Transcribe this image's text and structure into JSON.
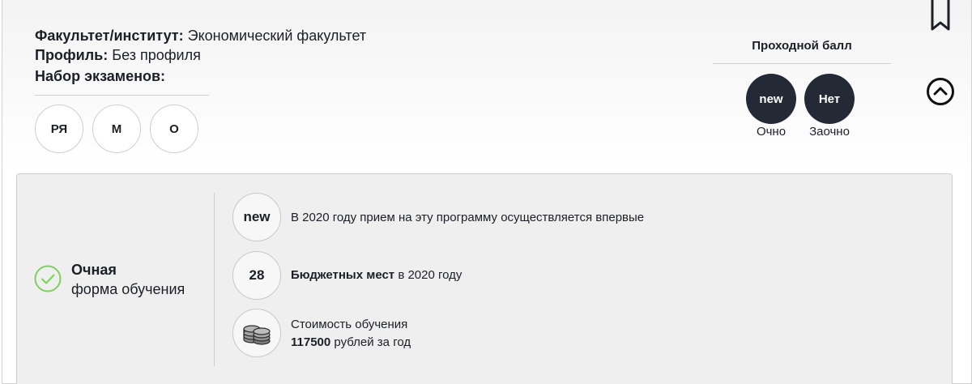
{
  "header": {
    "faculty_label": "Факультет/институт:",
    "faculty_value": "Экономический факультет",
    "profile_label": "Профиль:",
    "profile_value": "Без профиля",
    "exams_title": "Набор экзаменов:",
    "exams": [
      "РЯ",
      "М",
      "О"
    ]
  },
  "passing_score": {
    "title": "Проходной балл",
    "items": [
      {
        "value": "new",
        "label": "Очно"
      },
      {
        "value": "Нет",
        "label": "Заочно"
      }
    ]
  },
  "icons": {
    "bookmark": "bookmark-icon",
    "collapse": "chevron-up-circle-icon",
    "check": "check-circle-icon",
    "coins": "coins-icon"
  },
  "colors": {
    "dark_circle": "#232a35",
    "check_green": "#7fcf5e",
    "panel_bg": "#efefef"
  },
  "study_form": {
    "title": "Очная",
    "subtitle": "форма обучения"
  },
  "details": {
    "new_badge": "new",
    "new_text": "В 2020 году прием на эту программу осуществляется впервые",
    "budget_count": "28",
    "budget_bold": "Бюджетных мест",
    "budget_rest": " в 2020 году",
    "cost_label": "Стоимость обучения",
    "cost_amount": "117500",
    "cost_rest": " рублей за год"
  }
}
